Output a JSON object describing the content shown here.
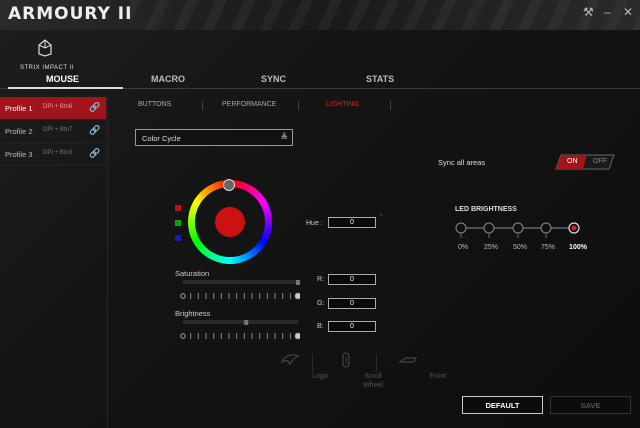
{
  "app": {
    "title": "ARMOURY II"
  },
  "window_controls": {
    "settings_glyph": "⚒",
    "minimize_glyph": "–",
    "close_glyph": "✕"
  },
  "device": {
    "name": "STRIX IMPACT II"
  },
  "main_tabs": [
    {
      "label": "MOUSE",
      "active": true
    },
    {
      "label": "MACRO"
    },
    {
      "label": "SYNC"
    },
    {
      "label": "STATS"
    }
  ],
  "profiles": [
    {
      "name": "Profile 1",
      "info": "DPI + Btn6",
      "active": true
    },
    {
      "name": "Profile 2",
      "info": "DPI + Btn7"
    },
    {
      "name": "Profile 3",
      "info": "DPI + Btn3"
    }
  ],
  "sub_tabs": [
    {
      "label": "BUTTONS"
    },
    {
      "label": "PERFORMANCE"
    },
    {
      "label": "LIGHTING",
      "active": true
    }
  ],
  "lighting": {
    "effect": "Color Cycle",
    "sync_label": "Sync all areas",
    "sync_on": "ON",
    "sync_off": "OFF",
    "hue_label": "Hue :",
    "hue_value": "0",
    "hue_unit": "°",
    "r_label": "R:",
    "r_value": "0",
    "g_label": "G:",
    "g_value": "0",
    "b_label": "B:",
    "b_value": "0",
    "saturation_label": "Saturation",
    "brightness_label": "Brightness",
    "saturation_level": 1.0,
    "brightness_level": 0.55
  },
  "led_brightness": {
    "label": "LED BRIGHTNESS",
    "levels": [
      "0%",
      "25%",
      "50%",
      "75%",
      "100%"
    ],
    "selected_index": 4
  },
  "zones": [
    {
      "label": "Logo"
    },
    {
      "label": "Scroll\nWheel"
    },
    {
      "label": "Front"
    }
  ],
  "buttons": {
    "default": "DEFAULT",
    "save": "SAVE"
  },
  "colors": {
    "accent": "#d3222c",
    "active_profile": "#a0141c",
    "selected_red": "#cc1111"
  }
}
